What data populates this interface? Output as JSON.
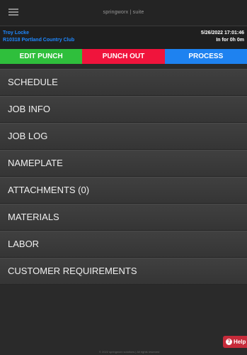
{
  "app": {
    "brand": "springworx | suite"
  },
  "header": {
    "user_name": "Troy Locke",
    "job": "R10318 Portland Country Club",
    "datetime": "5/26/2022 17:01:46",
    "time_in": "In for 0h 0m"
  },
  "actions": {
    "edit_punch": "EDIT PUNCH",
    "punch_out": "PUNCH OUT",
    "process": "PROCESS"
  },
  "menu": [
    {
      "label": "SCHEDULE"
    },
    {
      "label": "JOB INFO"
    },
    {
      "label": "JOB LOG"
    },
    {
      "label": "NAMEPLATE"
    },
    {
      "label": "ATTACHMENTS (0)"
    },
    {
      "label": "MATERIALS"
    },
    {
      "label": "LABOR"
    },
    {
      "label": "CUSTOMER REQUIREMENTS"
    }
  ],
  "help": {
    "label": "Help"
  },
  "footer": {
    "text": "© 2022 springworx solutions | All rights reserved"
  },
  "colors": {
    "accent_blue": "#1e88ff",
    "edit_green": "#2fbf3c",
    "punch_red": "#f0143c",
    "process_blue": "#1e82f0",
    "help_red": "#c62b3a"
  }
}
